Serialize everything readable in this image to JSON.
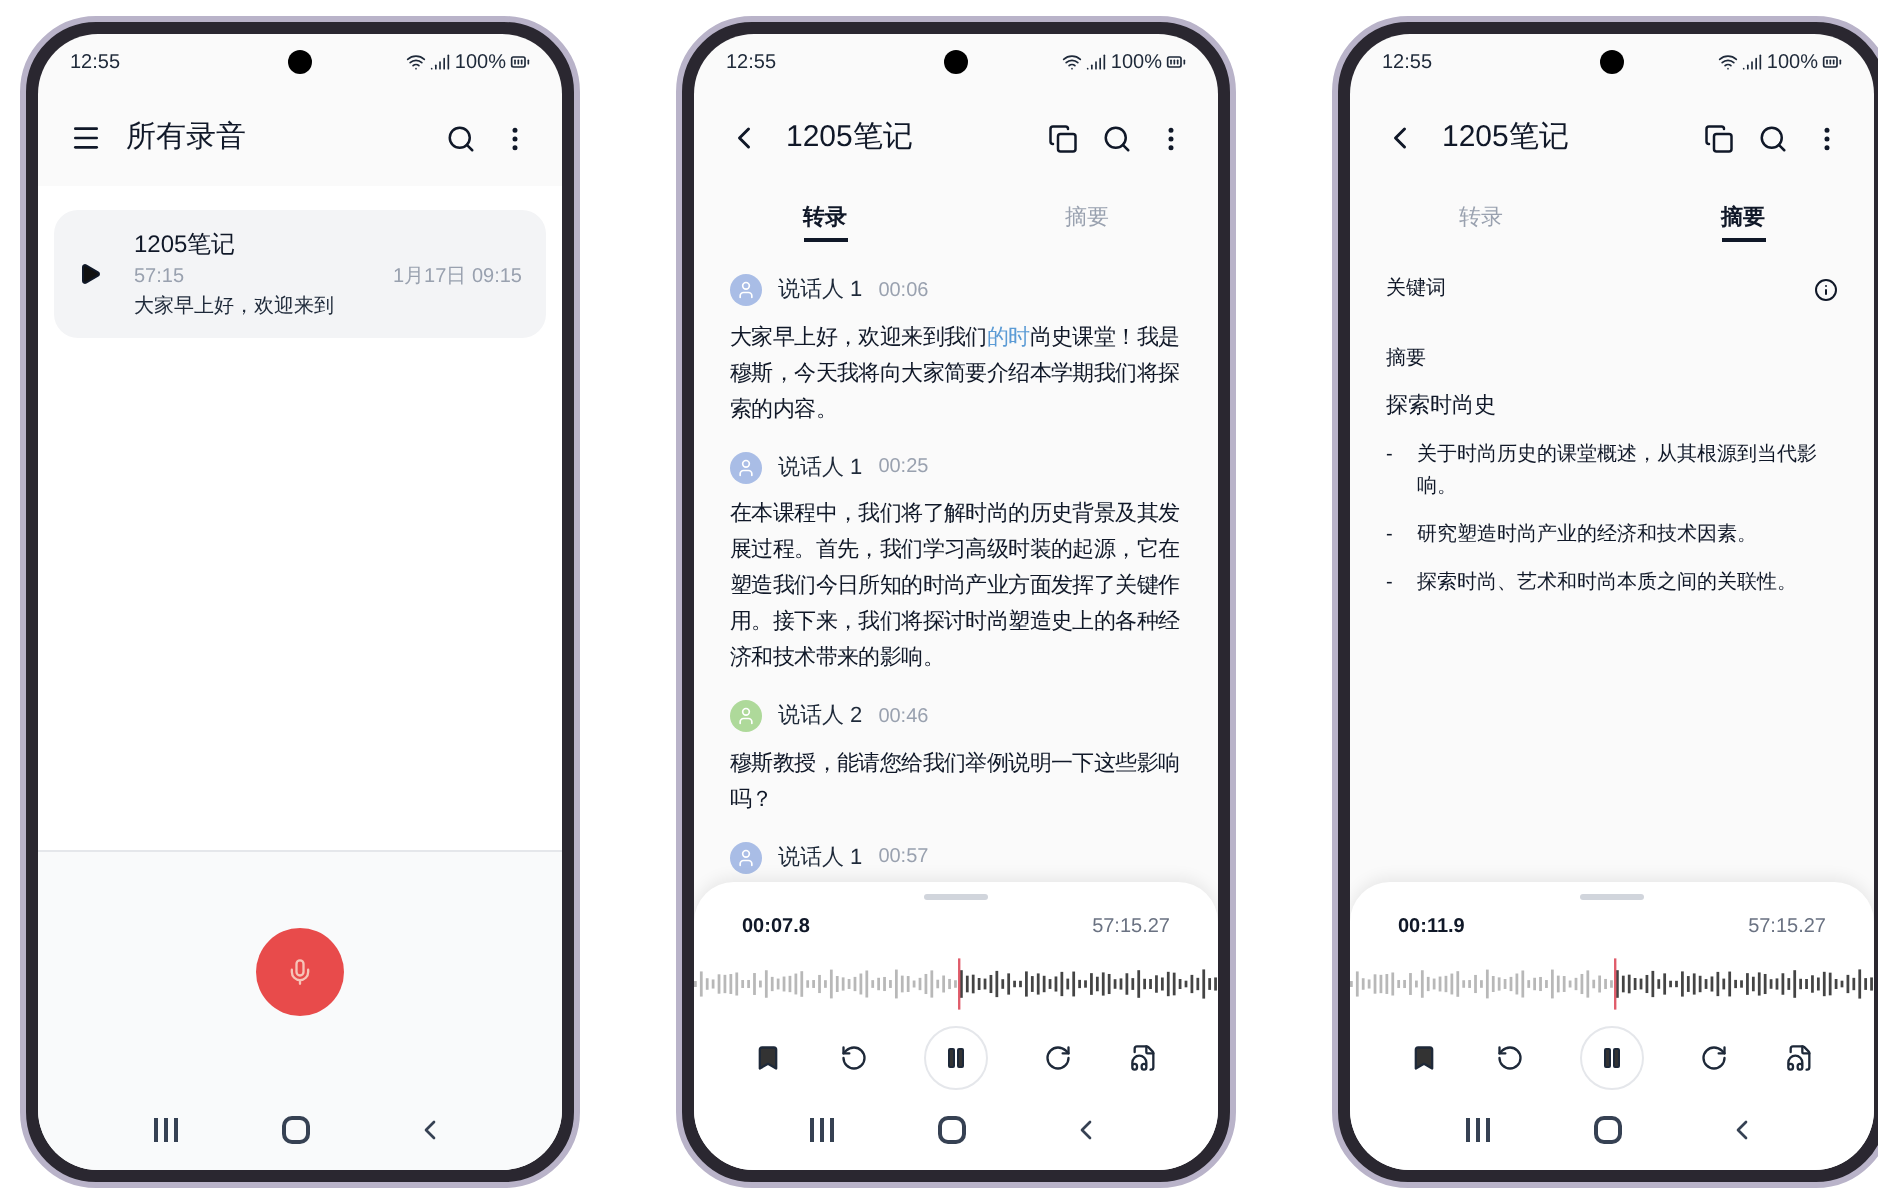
{
  "phones": [
    {
      "kind": "list",
      "status_bar": {
        "time": "12:55",
        "battery": "100%"
      },
      "app_bar": {
        "title": "所有录音"
      },
      "recordings": [
        {
          "title": "1205笔记",
          "duration": "57:15",
          "date": "1月17日 09:15",
          "preview": "大家早上好，欢迎来到"
        }
      ]
    },
    {
      "kind": "transcript",
      "status_bar": {
        "time": "12:55",
        "battery": "100%"
      },
      "app_bar": {
        "title": "1205笔记"
      },
      "tabs": [
        {
          "label": "转录",
          "selected": true
        },
        {
          "label": "摘要",
          "selected": false
        }
      ],
      "segments": [
        {
          "speaker": "说话人 1",
          "time": "00:06",
          "color": "#a9bde6",
          "text": [
            {
              "t": "大家早上好，欢迎来到我们",
              "highlight": false
            },
            {
              "t": "的时",
              "highlight": true
            },
            {
              "t": "尚史课堂！我是穆斯，今天我将向大家简要介绍本学期我们将探索的内容。",
              "highlight": false
            }
          ]
        },
        {
          "speaker": "说话人 1",
          "time": "00:25",
          "color": "#a9bde6",
          "text": [
            {
              "t": "在本课程中，我们将了解时尚的历史背景及其发展过程。首先，我们学习高级时装的起源，它在塑造我们今日所知的时尚产业方面发挥了关键作用。接下来，我们将探讨时尚塑造史上的各种经济和技术带来的影响。",
              "highlight": false
            }
          ]
        },
        {
          "speaker": "说话人 2",
          "time": "00:46",
          "color": "#aed99a",
          "text": [
            {
              "t": "穆斯教授，能请您给我们举例说明一下这些影响吗？",
              "highlight": false
            }
          ]
        },
        {
          "speaker": "说话人 1",
          "time": "00:57",
          "color": "#a9bde6"
        }
      ],
      "player": {
        "elapsed": "00:07.8",
        "total": "57:15.27"
      }
    },
    {
      "kind": "summary",
      "status_bar": {
        "time": "12:55",
        "battery": "100%"
      },
      "app_bar": {
        "title": "1205笔记"
      },
      "tabs": [
        {
          "label": "转录",
          "selected": false
        },
        {
          "label": "摘要",
          "selected": true
        }
      ],
      "keywords_label": "关键词",
      "summary_label": "摘要",
      "summary_title": "探索时尚史",
      "bullets": [
        {
          "marker": "-",
          "text": "关于时尚历史的课堂概述，从其根源到当代影响。"
        },
        {
          "marker": "-",
          "text": "研究塑造时尚产业的经济和技术因素。"
        },
        {
          "marker": "-",
          "text": "探索时尚、艺术和时尚本质之间的关联性。"
        }
      ],
      "player": {
        "elapsed": "00:11.9",
        "total": "57:15.27"
      }
    }
  ]
}
